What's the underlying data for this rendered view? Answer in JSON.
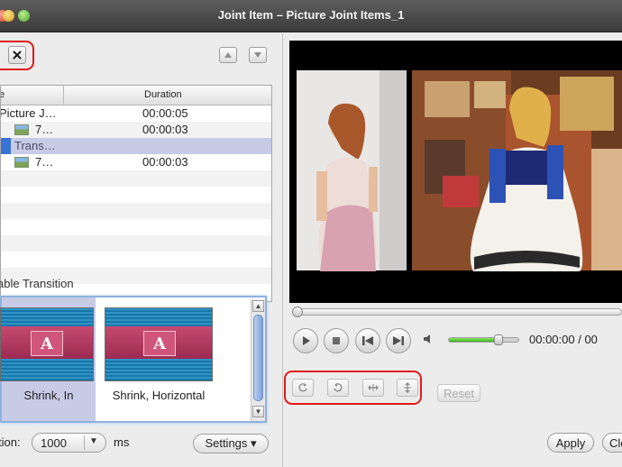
{
  "window": {
    "title": "Joint Item – Picture Joint Items_1"
  },
  "left_toolbar": {
    "delete_icon": "close-x-icon",
    "move_up_icon": "triangle-up-icon",
    "move_down_icon": "triangle-down-icon"
  },
  "item_table": {
    "columns": [
      "e",
      "Duration"
    ],
    "rows": [
      {
        "name": "Picture J…",
        "duration": "00:00:05",
        "indent": 0,
        "thumb": false,
        "selected": false
      },
      {
        "name": "7…",
        "duration": "00:00:03",
        "indent": 1,
        "thumb": true,
        "selected": false
      },
      {
        "name": "Trans…",
        "duration": "",
        "indent": 1,
        "thumb": false,
        "selected": true
      },
      {
        "name": "7…",
        "duration": "00:00:03",
        "indent": 1,
        "thumb": true,
        "selected": false
      }
    ]
  },
  "transitions": {
    "section_label": "able Transition",
    "items": [
      {
        "label": "Shrink, In",
        "letter": "A",
        "selected": true
      },
      {
        "label": "Shrink, Horizontal",
        "letter": "A",
        "selected": false
      }
    ]
  },
  "duration_control": {
    "label": "tion:",
    "value": "1000",
    "unit": "ms"
  },
  "settings_button": {
    "label": "Settings ▾"
  },
  "player": {
    "progress_fraction": 0.0,
    "volume_fraction": 0.72,
    "time": "00:00:00 / 00",
    "play_icon": "play-icon",
    "stop_icon": "stop-icon",
    "prev_icon": "skip-back-icon",
    "next_icon": "skip-forward-icon",
    "volume_icon": "speaker-icon"
  },
  "edit_tools": {
    "rotate_cw_icon": "rotate-clockwise-icon",
    "rotate_ccw_icon": "rotate-counterclockwise-icon",
    "flip_horizontal_icon": "flip-horizontal-icon",
    "flip_vertical_icon": "flip-vertical-icon",
    "reset_label": "Reset"
  },
  "dialog_buttons": {
    "apply_label": "Apply",
    "close_label": "Clo"
  },
  "colors": {
    "selection_row": "#c8cbe6",
    "highlight_ring": "#e11a1a",
    "tile_selected_bg": "#c8cbe6",
    "volume_fill": "#4fc02c"
  }
}
